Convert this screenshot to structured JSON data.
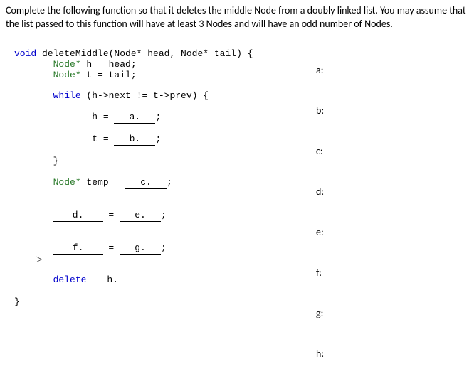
{
  "intro": "Complete the following function so that it deletes the middle Node from a doubly linked list.  You may assume that the list passed to this function will have at least 3 Nodes and will have an odd number of Nodes.",
  "code": {
    "sig_void": "void",
    "sig_rest": " deleteMiddle(Node* head, Node* tail) {",
    "l_h_type": "Node*",
    "l_h_rest": " h = head;",
    "l_t_type": "Node*",
    "l_t_rest": " t = tail;",
    "while_kw": "while",
    "while_cond": " (h->next != t->prev) {",
    "h_eq": "h = ",
    "blank_a": "a.",
    "semi": ";",
    "t_eq": "t = ",
    "blank_b": "b.",
    "close_brace1": "}",
    "temp_type": "Node*",
    "temp_rest": " temp = ",
    "blank_c": "c.",
    "blank_d": "d.",
    "eq": " = ",
    "blank_e": "e.",
    "blank_f": "f.",
    "blank_g": "g.",
    "delete_kw": "delete",
    "blank_h": "h.",
    "close_brace2": "}"
  },
  "answers": {
    "a": "a:",
    "b": "b:",
    "c": "c:",
    "d": "d:",
    "e": "e:",
    "f": "f:",
    "g": "g:",
    "h": "h:"
  },
  "cursor_glyph": "▷"
}
